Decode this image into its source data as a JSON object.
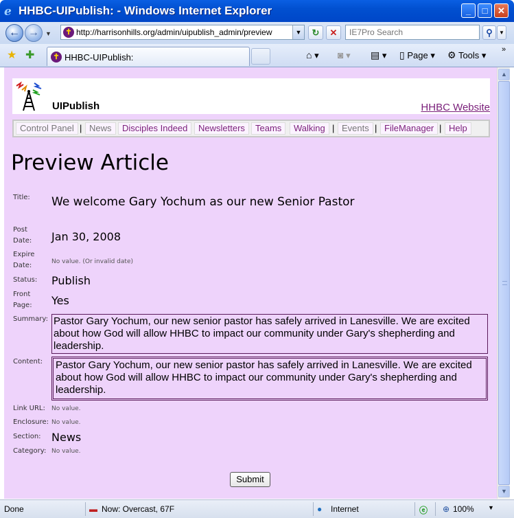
{
  "window": {
    "title": "HHBC-UIPublish: - Windows Internet Explorer"
  },
  "toolbar": {
    "url": "http://harrisonhills.org/admin/uipublish_admin/preview",
    "search_placeholder": "IE7Pro Search",
    "tab_title": "HHBC-UIPublish:",
    "page_label": "Page",
    "tools_label": "Tools"
  },
  "header": {
    "app_name": "UIPublish",
    "site_link": "HHBC Website"
  },
  "nav": {
    "items": [
      "Control Panel",
      "News",
      "Disciples Indeed",
      "Newsletters",
      "Teams",
      "Walking",
      "Events",
      "FileManager",
      "Help"
    ]
  },
  "page": {
    "title": "Preview Article"
  },
  "article": {
    "title_label": "Title:",
    "title_value": "We welcome Gary Yochum as our new Senior Pastor",
    "post_date_label_1": "Post",
    "post_date_label_2": "Date:",
    "post_date_value": "Jan 30, 2008",
    "expire_date_label_1": "Expire",
    "expire_date_label_2": "Date:",
    "expire_date_value": "No value. (Or invalid date)",
    "status_label": "Status:",
    "status_value": "Publish",
    "front_page_label_1": "Front",
    "front_page_label_2": "Page:",
    "front_page_value": "Yes",
    "summary_label": "Summary:",
    "summary_value": "Pastor Gary Yochum, our new senior pastor has safely arrived in Lanesville. We are excited about how God will allow HHBC to impact our community under Gary's shepherding and leadership.",
    "content_label": "Content:",
    "content_value": "Pastor Gary Yochum, our new senior pastor has safely arrived in Lanesville.  We are excited about how God will allow HHBC to impact our community under Gary's shepherding and leadership.",
    "link_url_label": "Link URL:",
    "link_url_value": "No value.",
    "enclosure_label": "Enclosure:",
    "enclosure_value": "No value.",
    "section_label": "Section:",
    "section_value": "News",
    "category_label": "Category:",
    "category_value": "No value.",
    "submit_label": "Submit"
  },
  "statusbar": {
    "status": "Done",
    "weather": "Now: Overcast, 67F",
    "zone": "Internet",
    "zoom": "100%"
  }
}
